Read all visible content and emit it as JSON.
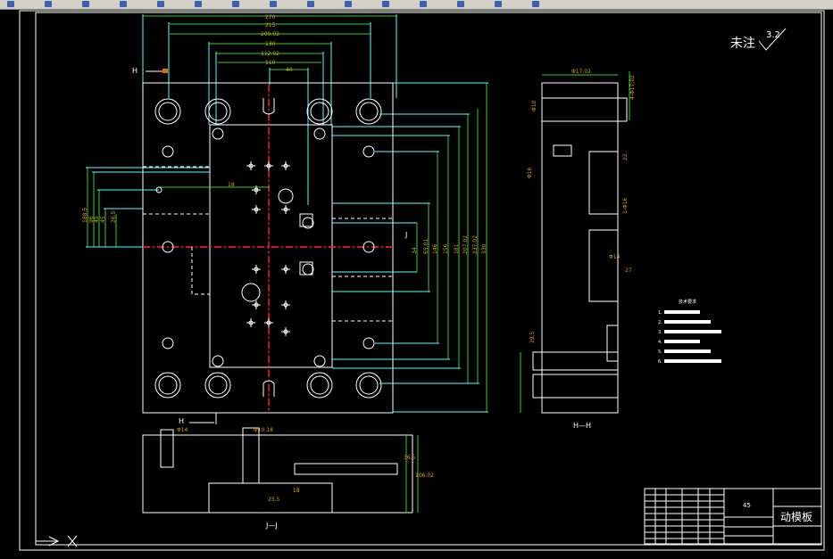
{
  "toolbar": {
    "icons": [
      "new",
      "open",
      "save",
      "print",
      "undo",
      "redo",
      "pan",
      "zoom",
      "properties",
      "layer",
      "color",
      "linetype",
      "text",
      "table",
      "help"
    ]
  },
  "drawing": {
    "roughness_label": "未注",
    "roughness_value": "3.2",
    "top_dims": [
      "270",
      "215",
      "209.02",
      "130",
      "112.02",
      "110",
      "40"
    ],
    "right_dims": [
      "34",
      "65.01",
      "146",
      "156",
      "181",
      "207.02",
      "237.02",
      "330"
    ],
    "left_dims": [
      "188.5",
      "96",
      "45",
      "45",
      "26.5"
    ],
    "mid_dim": "18",
    "side_dims": [
      "Φ17.02",
      "4-Φ17.02",
      "Φ10",
      "Φ16",
      "22",
      "1-Φ16",
      "Φ14",
      "27",
      "29.5"
    ],
    "section_dims": [
      "Φ14",
      "Φ10.18",
      "25.5",
      "18",
      "36.5",
      "106.02"
    ],
    "view_labels": {
      "h_top": "H",
      "h_bottom": "H",
      "j_right": "J",
      "hh": "H—H",
      "jj": "J—J"
    },
    "notes_title": "技术要求",
    "notes": [
      "1.",
      "2.",
      "3.",
      "4.",
      "5.",
      "6."
    ]
  },
  "title_block": {
    "material": "45",
    "part_name": "动模板"
  },
  "colors": {
    "background": "#000000",
    "outline": "#ffffff",
    "extension": "#55ffff",
    "dimension": "#33cc33",
    "text": "#e0a000",
    "centerline": "#ff2222"
  }
}
